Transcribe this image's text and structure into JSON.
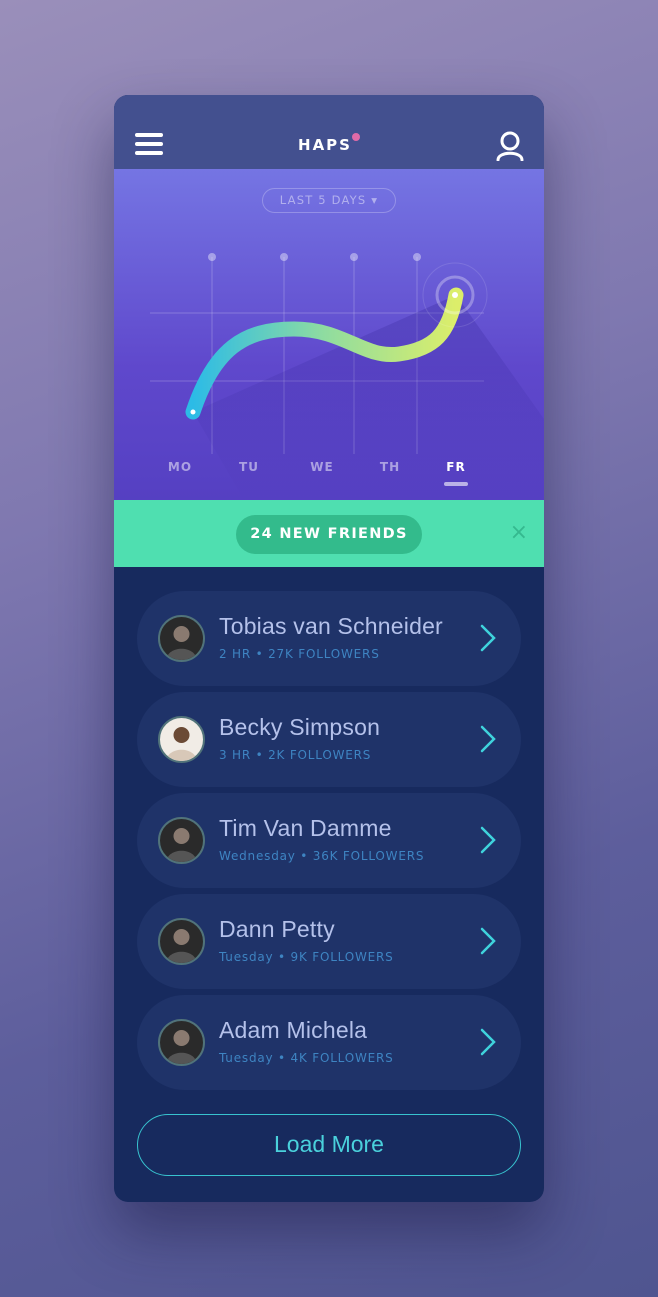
{
  "header": {
    "title": "HAPS",
    "notification_color": "#e06aa8",
    "menu_icon": "hamburger-icon",
    "profile_icon": "user-icon"
  },
  "chart_data": {
    "type": "line",
    "range_selector": "LAST 5 DAYS ▾",
    "categories": [
      "MO",
      "TU",
      "WE",
      "TH",
      "FR"
    ],
    "selected": "FR",
    "grid": true,
    "gradient_colors": [
      "#2cbbe6",
      "#d8ec6c"
    ]
  },
  "banner": {
    "label": "24 NEW FRIENDS",
    "close": "×",
    "color": "#4fdfb0"
  },
  "friends": [
    {
      "name": "Tobias van Schneider",
      "meta": "2 HR • 27K FOLLOWERS"
    },
    {
      "name": "Becky Simpson",
      "meta": "3 HR • 2K FOLLOWERS"
    },
    {
      "name": "Tim Van Damme",
      "meta": "Wednesday • 36K FOLLOWERS"
    },
    {
      "name": "Dann Petty",
      "meta": "Tuesday • 9K FOLLOWERS"
    },
    {
      "name": "Adam Michela",
      "meta": "Tuesday • 4K FOLLOWERS"
    }
  ],
  "load_more": "Load More"
}
